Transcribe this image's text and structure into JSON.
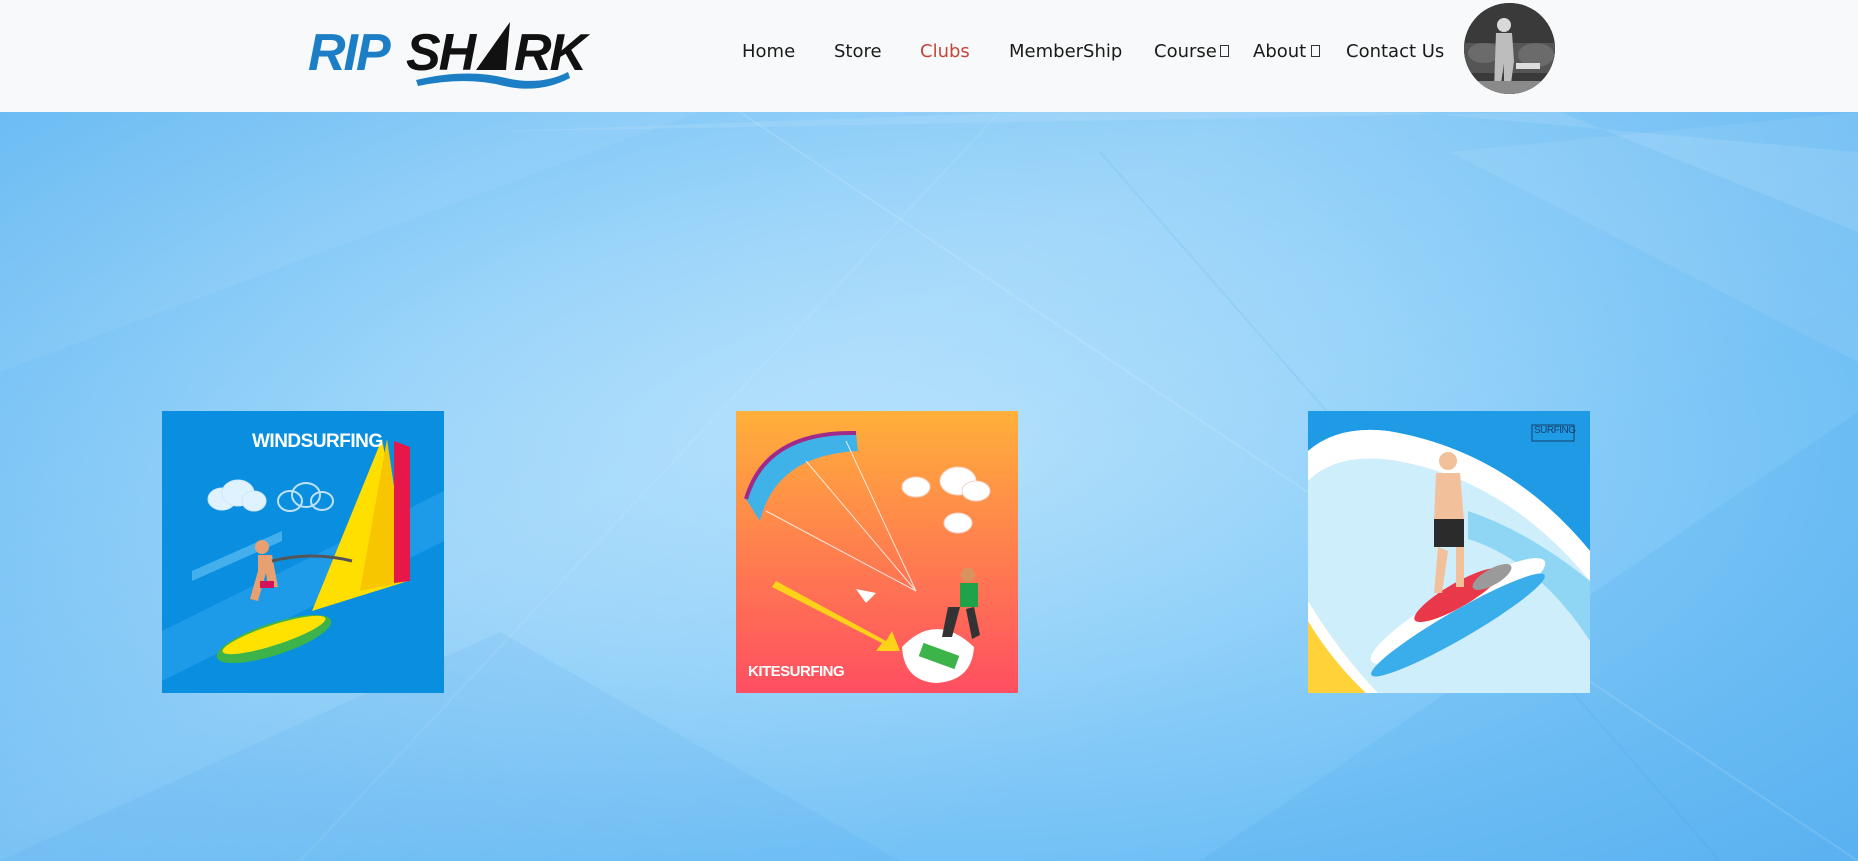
{
  "brand": {
    "name": "RIPSHARK",
    "logo_icon": "shark-fin-wave-logo"
  },
  "nav": {
    "items": [
      {
        "label": "Home",
        "active": false,
        "has_dropdown": false
      },
      {
        "label": "Store",
        "active": false,
        "has_dropdown": false
      },
      {
        "label": "Clubs",
        "active": true,
        "has_dropdown": false
      },
      {
        "label": "MemberShip",
        "active": false,
        "has_dropdown": false
      },
      {
        "label": "Course",
        "active": false,
        "has_dropdown": true
      },
      {
        "label": "About",
        "active": false,
        "has_dropdown": true
      },
      {
        "label": "Contact Us",
        "active": false,
        "has_dropdown": false
      }
    ],
    "active_color": "#c4463a"
  },
  "user": {
    "avatar_icon": "user-avatar-photo"
  },
  "clubs": [
    {
      "label": "WINDSURFING",
      "image_icon": "windsurfing-illustration",
      "bg_color": "#0a8fe0"
    },
    {
      "label": "KITESURFING",
      "image_icon": "kitesurfing-illustration",
      "bg_color": "#ff7a4a"
    },
    {
      "label": "SURFING",
      "image_icon": "surfing-illustration",
      "bg_color": "#cfeefc"
    }
  ]
}
